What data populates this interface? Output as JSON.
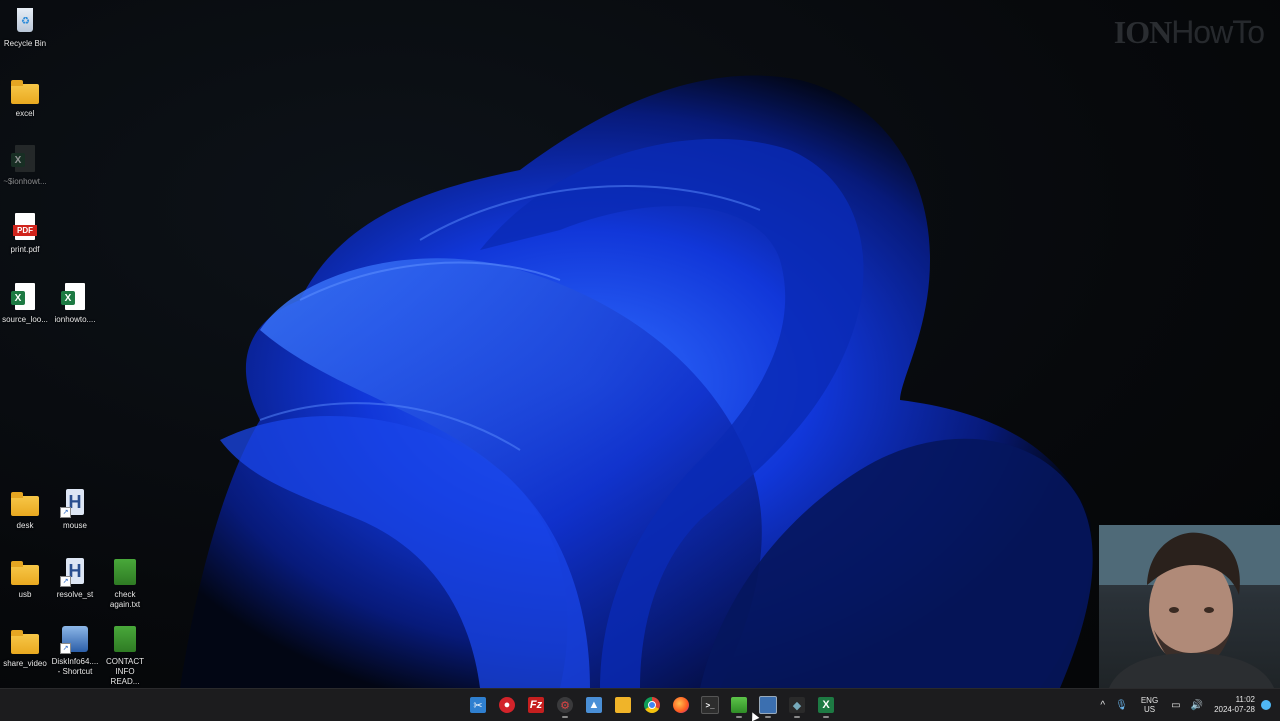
{
  "watermark": {
    "brand": "ION",
    "suffix": "HowTo"
  },
  "desktop": {
    "icons": {
      "recycle_bin": "Recycle Bin",
      "excel_folder": "excel",
      "temp_excel": "~$ionhowt...",
      "print_pdf": "print.pdf",
      "source_loc": "source_loo...",
      "ionhowto_xlsx": "ionhowto....",
      "desk": "desk",
      "mouse": "mouse",
      "usb": "usb",
      "resolve_st": "resolve_st",
      "check_again": "check\nagain.txt",
      "share_video": "share_video",
      "diskinfo": "DiskInfo64....\n- Shortcut",
      "contact_info": "CONTACT\nINFO READ..."
    }
  },
  "taskbar": {
    "icons": [
      "start-icon",
      "snipping-tool-icon",
      "record-icon",
      "filezilla-icon",
      "settings-gear-icon",
      "photos-icon",
      "file-explorer-icon",
      "chrome-icon",
      "firefox-icon",
      "terminal-icon",
      "notepad-icon",
      "remote-desktop-icon",
      "app-icon",
      "excel-icon"
    ],
    "tray": {
      "lang_top": "ENG",
      "lang_bottom": "US",
      "time": "11:02",
      "date": "2024-07-28"
    }
  },
  "colors": {
    "wallpaper_accent": "#1f4cff",
    "taskbar_bg": "#1c1c1e",
    "notification": "#4fb7f5"
  }
}
